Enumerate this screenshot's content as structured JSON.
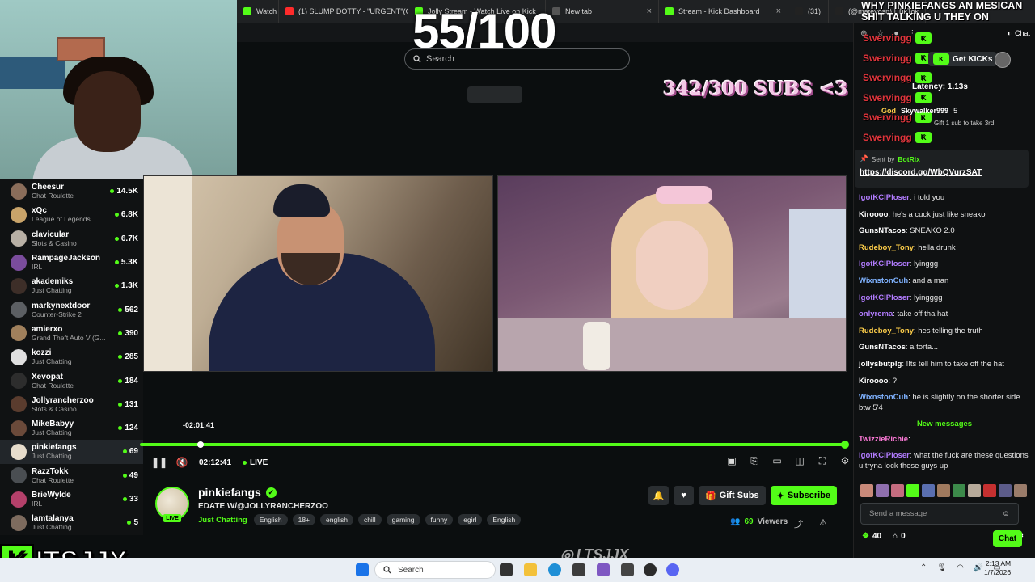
{
  "browser_tabs": [
    {
      "label": "Watch L",
      "color": "#53fc18"
    },
    {
      "label": "(1) SLUMP DOTTY - \"URGENT\"(ON",
      "color": "#ff2b2b"
    },
    {
      "label": "Jolly Stream - Watch Live on Kick",
      "color": "#53fc18"
    },
    {
      "label": "New tab",
      "color": "#555555"
    },
    {
      "label": "Stream - Kick Dashboard",
      "color": "#53fc18"
    },
    {
      "label": "(31)",
      "color": "#222222"
    },
    {
      "label": "(@mateyosn) | TikTok",
      "color": "#222222"
    }
  ],
  "overlay": {
    "counter": "55/100",
    "subs": "342/300 SUBS <3",
    "top_text": "WHY PINKIEFANGS AN MESICAN SHIT TALKING U THEY ON"
  },
  "search": {
    "placeholder": "Search"
  },
  "sidebar": {
    "channels": [
      {
        "name": "Cheesur",
        "category": "Chat Roulette",
        "viewers": "14.5K",
        "color": "#8a6d5a"
      },
      {
        "name": "xQc",
        "category": "League of Legends",
        "viewers": "6.8K",
        "color": "#c9a46a"
      },
      {
        "name": "clavicular",
        "category": "Slots & Casino",
        "viewers": "6.7K",
        "color": "#b8b0a5"
      },
      {
        "name": "RampageJackson",
        "category": "IRL",
        "viewers": "5.3K",
        "color": "#7a4c9c"
      },
      {
        "name": "akademiks",
        "category": "Just Chatting",
        "viewers": "1.3K",
        "color": "#3d2e28"
      },
      {
        "name": "markynextdoor",
        "category": "Counter-Strike 2",
        "viewers": "562",
        "color": "#5c5f63"
      },
      {
        "name": "amierxo",
        "category": "Grand Theft Auto V (G...",
        "viewers": "390",
        "color": "#a0805c"
      },
      {
        "name": "kozzi",
        "category": "Just Chatting",
        "viewers": "285",
        "color": "#e0e0e0"
      },
      {
        "name": "Xevopat",
        "category": "Chat Roulette",
        "viewers": "184",
        "color": "#2d2d2d"
      },
      {
        "name": "Jollyrancherzoo",
        "category": "Slots & Casino",
        "viewers": "131",
        "color": "#5a3c2e"
      },
      {
        "name": "MikeBabyy",
        "category": "Just Chatting",
        "viewers": "124",
        "color": "#6b4a3a"
      },
      {
        "name": "pinkiefangs",
        "category": "Just Chatting",
        "viewers": "69",
        "color": "#e6dccb"
      },
      {
        "name": "RazzTokk",
        "category": "Chat Roulette",
        "viewers": "49",
        "color": "#4a4e52"
      },
      {
        "name": "BrieWylde",
        "category": "IRL",
        "viewers": "33",
        "color": "#b4406a"
      },
      {
        "name": "lamtalanya",
        "category": "Just Chatting",
        "viewers": "5",
        "color": "#7d6b5e"
      }
    ]
  },
  "player": {
    "time_tooltip": "-02:01:41",
    "elapsed": "02:12:41",
    "live_label": "LIVE",
    "progress": 1.0
  },
  "stream": {
    "streamer": "pinkiefangs",
    "live_badge": "LIVE",
    "title": "EDATE W/@JOLLYRANCHERZOO",
    "category": "Just Chatting",
    "tags": [
      "English",
      "18+",
      "english",
      "chill",
      "gaming",
      "funny",
      "egirl",
      "English"
    ],
    "viewers_count": "69",
    "viewers_label": "Viewers",
    "gift_label": "Gift Subs",
    "subscribe_label": "Subscribe"
  },
  "chat": {
    "header_label": "Chat",
    "swervingg": [
      "Swervingg",
      "Swervingg",
      "Swervingg",
      "Swervingg",
      "Swervingg",
      "Swervingg"
    ],
    "get_kicks": "Get KICKs",
    "latency": "Latency: 1.13s",
    "leader_god": "God",
    "leader_name": "Skywalker999",
    "leader_count": "5",
    "leader_note": "Gift 1 sub to take 3rd",
    "pinned_by_label": "Sent by",
    "pinned_by": "BotRix",
    "pinned_link": "https://discord.gg/WbQVurzSAT",
    "messages": [
      {
        "user": "IgotKCIPloser",
        "color": "#b27cff",
        "text": "i told you"
      },
      {
        "user": "Kiroooo",
        "color": "#ffffff",
        "text": "he's a cuck just like sneako"
      },
      {
        "user": "GunsNTacos",
        "color": "#ffffff",
        "text": "SNEAKO 2.0"
      },
      {
        "user": "Rudeboy_Tony",
        "color": "#ffcf4a",
        "text": "hella drunk"
      },
      {
        "user": "IgotKCIPloser",
        "color": "#b27cff",
        "text": "lyinggg"
      },
      {
        "user": "WixnstonCuh",
        "color": "#7fb2ff",
        "text": "and a man"
      },
      {
        "user": "IgotKCIPloser",
        "color": "#b27cff",
        "text": "lyingggg"
      },
      {
        "user": "onlyrema",
        "color": "#b27cff",
        "text": "take off tha hat"
      },
      {
        "user": "Rudeboy_Tony",
        "color": "#ffcf4a",
        "text": "hes telling the truth"
      },
      {
        "user": "GunsNTacos",
        "color": "#ffffff",
        "text": "a torta..."
      },
      {
        "user": "jollysbutplg",
        "color": "#ffffff",
        "text": "!!ts tell him to take off the hat"
      },
      {
        "user": "Kiroooo",
        "color": "#ffffff",
        "text": "?"
      },
      {
        "user": "WixnstonCuh",
        "color": "#7fb2ff",
        "text": "he is slightly on the shorter side btw 5'4"
      }
    ],
    "new_messages": "New messages",
    "after_messages": [
      {
        "user": "TwizzieRichie",
        "color": "#ff7ad9",
        "text": ""
      },
      {
        "user": "IgotKCIPloser",
        "color": "#b27cff",
        "text": "what the fuck are these questions u tryna lock these guys up"
      }
    ],
    "send_placeholder": "Send a message",
    "points": "40",
    "redeems": "0",
    "chat_button": "Chat"
  },
  "watermark": "LTSJJX",
  "logo_text": "ITSJJX",
  "taskbar": {
    "search_placeholder": "Search",
    "time": "2:13 AM",
    "date": "1/7/2026"
  },
  "colors": {
    "accent": "#53fc18",
    "background": "#0b0e0f"
  }
}
